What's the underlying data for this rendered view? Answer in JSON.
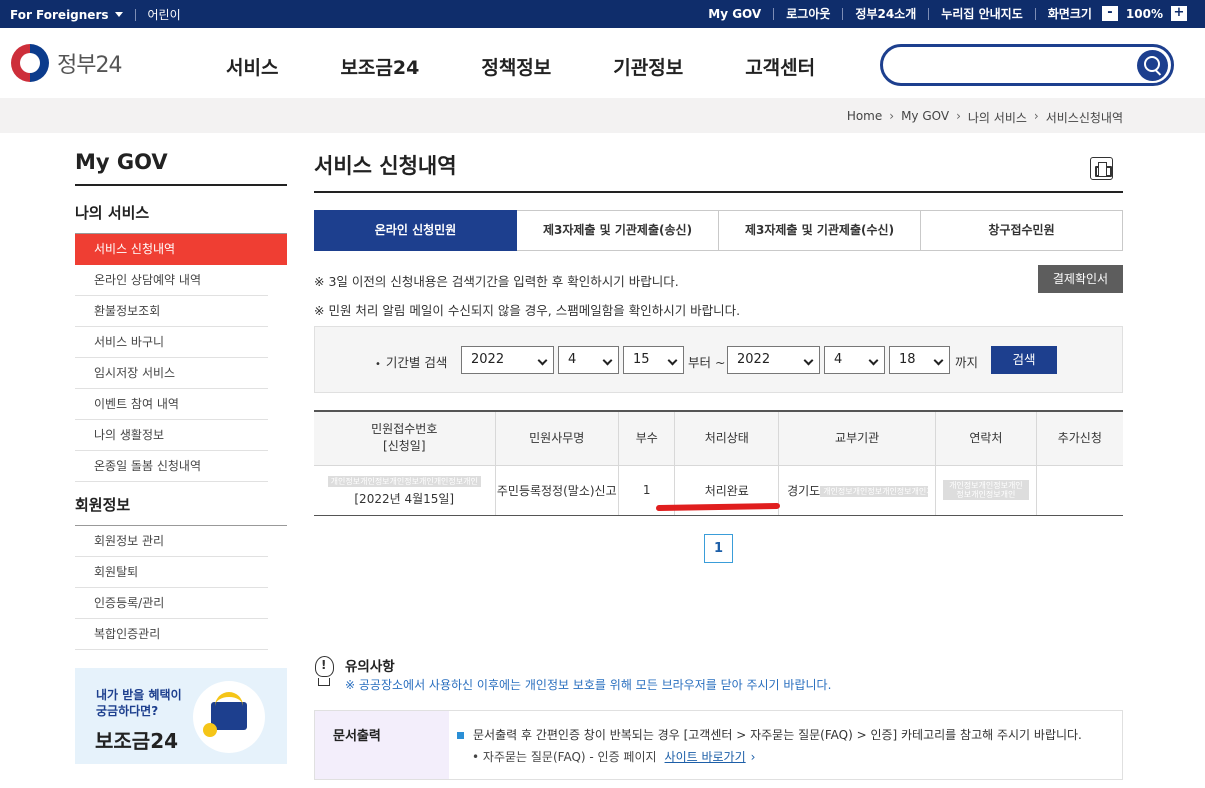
{
  "topbar": {
    "for_foreigners": "For Foreigners",
    "kids": "어린이",
    "links": [
      "My GOV",
      "로그아웃",
      "정부24소개",
      "누리집 안내지도"
    ],
    "screen_size": "화면크기",
    "zoom_minus": "-",
    "zoom_value": "100%",
    "zoom_plus": "+"
  },
  "header": {
    "logo_text": "정부24",
    "nav": [
      "서비스",
      "보조금24",
      "정책정보",
      "기관정보",
      "고객센터"
    ],
    "search_placeholder": ""
  },
  "breadcrumb": [
    "Home",
    "My GOV",
    "나의 서비스",
    "서비스신청내역"
  ],
  "sidebar": {
    "title": "My GOV",
    "section1": "나의 서비스",
    "items1": [
      "서비스 신청내역",
      "온라인 상담예약 내역",
      "환불정보조회",
      "서비스 바구니",
      "임시저장 서비스",
      "이벤트 참여 내역",
      "나의 생활정보",
      "온종일 돌봄 신청내역"
    ],
    "section2": "회원정보",
    "items2": [
      "회원정보 관리",
      "회원탈퇴",
      "인증등록/관리",
      "복합인증관리"
    ],
    "promo_line1": "내가 받을 혜택이",
    "promo_line2": "궁금하다면?",
    "promo_big": "보조금24"
  },
  "main": {
    "title": "서비스 신청내역",
    "tabs": [
      "온라인 신청민원",
      "제3자제출 및 기관제출(송신)",
      "제3자제출 및 기관제출(수신)",
      "창구접수민원"
    ],
    "note1": "※ 3일 이전의 신청내용은 검색기간을 입력한 후 확인하시기 바랍니다.",
    "note2": "※ 민원 처리 알림 메일이 수신되지 않을 경우, 스팸메일함을 확인하시기 바랍니다.",
    "payment_button": "결제확인서",
    "filter": {
      "label": "기간별 검색",
      "from_year": "2022",
      "from_month": "4",
      "from_day": "15",
      "from_text": "부터 ~",
      "to_year": "2022",
      "to_month": "4",
      "to_day": "18",
      "to_text": "까지",
      "search_button": "검색"
    },
    "table": {
      "headers": [
        "민원접수번호",
        "[신청일]",
        "민원사무명",
        "부수",
        "처리상태",
        "교부기관",
        "연락처",
        "추가신청"
      ],
      "row": {
        "receipt_masked": "개인정보개인정보개인정보개인개인정보개인",
        "date": "[2022년 4월15일]",
        "service": "주민등록정정(말소)신고",
        "count": "1",
        "status": "처리완료",
        "agency_prefix": "경기도",
        "agency_masked": "개인정보개인정보개인정보개인개인정보개인정보개인",
        "contact_masked": "개인정보개인정보개인정보개인정보개인",
        "extra": ""
      }
    },
    "pager": "1",
    "notice": {
      "title": "유의사항",
      "desc": "※ 공공장소에서 사용하신 이후에는 개인정보 보호를 위해 모든 브라우저를 닫아 주시기 바랍니다."
    },
    "doc": {
      "label": "문서출력",
      "line1": "문서출력 후 간편인증 창이 반복되는 경우 [고객센터 > 자주묻는 질문(FAQ) > 인증] 카테고리를 참고해 주시기 바랍니다.",
      "line2": "자주묻는 질문(FAQ) - 인증 페이지",
      "link": "사이트 바로가기",
      "link_arrow": "›"
    }
  }
}
